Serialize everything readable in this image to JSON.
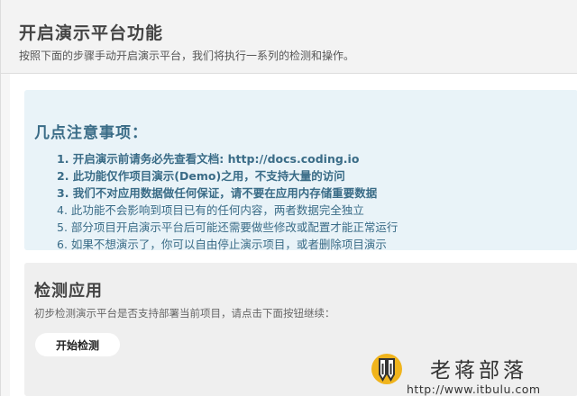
{
  "header": {
    "title": "开启演示平台功能",
    "description": "按照下面的步骤手动开启演示平台，我们将执行一系列的检测和操作。"
  },
  "notice": {
    "title": "几点注意事项：",
    "items": [
      "1. 开启演示前请务必先查看文档: http://docs.coding.io",
      "2. 此功能仅作项目演示(Demo)之用，不支持大量的访问",
      "3. 我们不对应用数据做任何保证，请不要在应用内存储重要数据",
      "4. 此功能不会影响到项目已有的任何内容，两者数据完全独立",
      "5. 部分项目开启演示平台后可能还需要做些修改或配置才能正常运行",
      "6. 如果不想演示了，你可以自由停止演示项目，或者删除项目演示"
    ]
  },
  "detect": {
    "title": "检测应用",
    "description": "初步检测演示平台是否支持部署当前项目，请点击下面按钮继续：",
    "button_label": "开始检测"
  },
  "watermark": {
    "name": "老蒋部落",
    "url": "http://www.itbulu.com",
    "icon": "pencil-shield-icon",
    "colors": {
      "shield": "#f0b41c",
      "pencil": "#333333"
    }
  },
  "colors": {
    "notice_background": "#e9f3f8",
    "notice_text": "#3a6c87",
    "detect_background": "#efefef",
    "header_background": "#f3f3f3"
  }
}
